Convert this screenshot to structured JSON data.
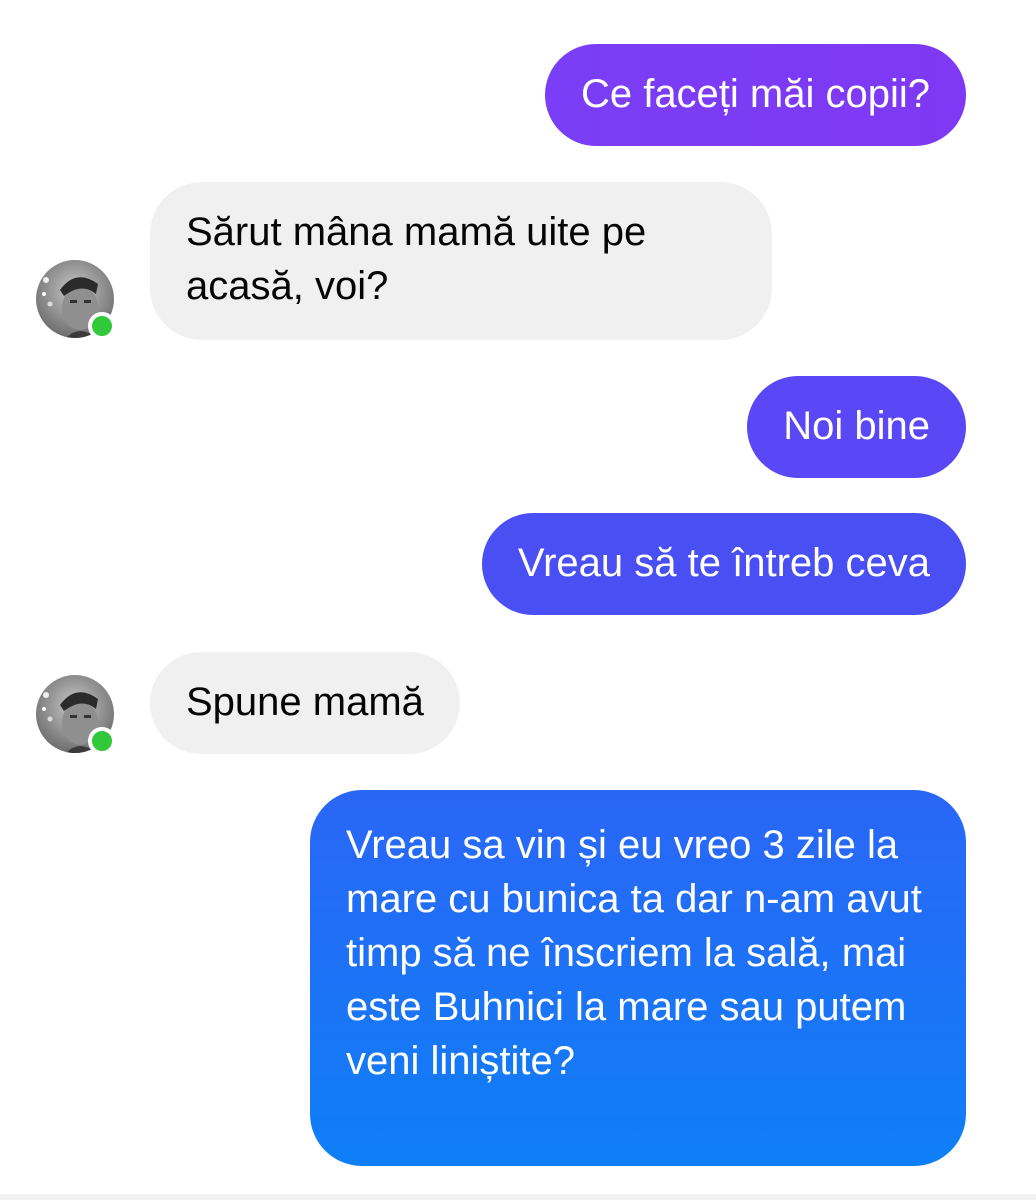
{
  "colors": {
    "bubble_1": "#7b3cf6",
    "bubble_3": "#5a47f5",
    "bubble_4": "#4a50f4",
    "bubble_6": "#1677f6",
    "incoming_bg": "#f0f0f0",
    "online": "#31c93a"
  },
  "messages": [
    {
      "direction": "outgoing",
      "text": "Ce faceți măi copii?"
    },
    {
      "direction": "incoming",
      "text": "Sărut mâna mamă  uite pe acasă, voi?",
      "avatar": "contact-avatar",
      "online": true
    },
    {
      "direction": "outgoing",
      "text": "Noi bine"
    },
    {
      "direction": "outgoing",
      "text": "Vreau să te întreb ceva"
    },
    {
      "direction": "incoming",
      "text": "Spune mamă",
      "avatar": "contact-avatar",
      "online": true
    },
    {
      "direction": "outgoing",
      "text": "Vreau sa vin și eu vreo 3 zile la mare cu bunica ta dar n-am avut timp să ne înscriem la sală, mai este Buhnici la mare sau putem veni liniștite?"
    }
  ]
}
